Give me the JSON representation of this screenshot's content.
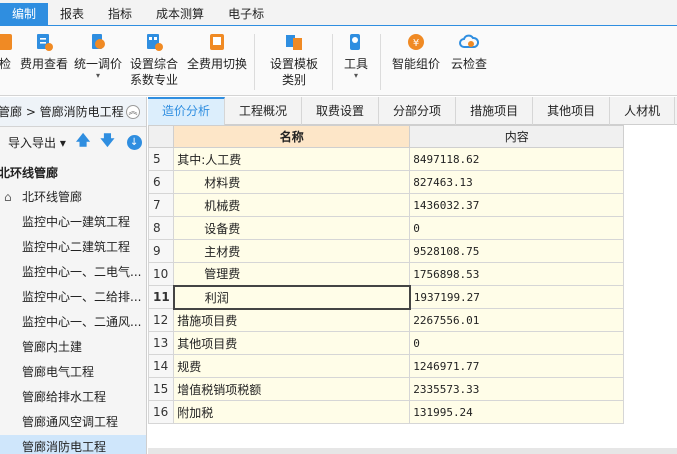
{
  "menu": [
    "编制",
    "报表",
    "指标",
    "成本测算",
    "电子标"
  ],
  "ribbon": {
    "buttons": [
      {
        "label1": "检",
        "label2": "",
        "icon": "check-icon",
        "dropdown": false
      },
      {
        "label1": "费用查看",
        "label2": "",
        "icon": "fee-view-icon",
        "dropdown": false
      },
      {
        "label1": "统一调价",
        "label2": "",
        "icon": "price-adjust-icon",
        "dropdown": true
      },
      {
        "label1": "设置综合",
        "label2": "系数专业",
        "icon": "calc-settings-icon",
        "dropdown": false
      },
      {
        "label1": "全费用切换",
        "label2": "",
        "icon": "full-fee-switch-icon",
        "dropdown": false
      },
      {
        "label1": "设置模板",
        "label2": "类别",
        "icon": "template-icon",
        "dropdown": false
      },
      {
        "label1": "工具",
        "label2": "",
        "icon": "tool-icon",
        "dropdown": true
      },
      {
        "label1": "智能组价",
        "label2": "",
        "icon": "smart-price-icon",
        "dropdown": false
      },
      {
        "label1": "云检查",
        "label2": "",
        "icon": "cloud-check-icon",
        "dropdown": false
      }
    ]
  },
  "breadcrumb": "管廊 > 管廊消防电工程",
  "left_panel": {
    "export_label": "导入导出",
    "root": "北环线管廊",
    "home": "北环线管廊",
    "items": [
      "监控中心一建筑工程",
      "监控中心二建筑工程",
      "监控中心一、二电气...",
      "监控中心一、二给排...",
      "监控中心一、二通风...",
      "管廊内土建",
      "管廊电气工程",
      "管廊给排水工程",
      "管廊通风空调工程",
      "管廊消防电工程"
    ]
  },
  "tabs": [
    "造价分析",
    "工程概况",
    "取费设置",
    "分部分项",
    "措施项目",
    "其他项目",
    "人材机"
  ],
  "grid": {
    "headers": {
      "name": "名称",
      "value": "内容"
    },
    "rows": [
      {
        "num": "5",
        "name": "其中:人工费",
        "value": "8497118.62",
        "indent": false
      },
      {
        "num": "6",
        "name": "材料费",
        "value": "827463.13",
        "indent": true
      },
      {
        "num": "7",
        "name": "机械费",
        "value": "1436032.37",
        "indent": true
      },
      {
        "num": "8",
        "name": "设备费",
        "value": "0",
        "indent": true
      },
      {
        "num": "9",
        "name": "主材费",
        "value": "9528108.75",
        "indent": true
      },
      {
        "num": "10",
        "name": "管理费",
        "value": "1756898.53",
        "indent": true
      },
      {
        "num": "11",
        "name": "利润",
        "value": "1937199.27",
        "indent": true
      },
      {
        "num": "12",
        "name": "措施项目费",
        "value": "2267556.01",
        "indent": false
      },
      {
        "num": "13",
        "name": "其他项目费",
        "value": "0",
        "indent": false
      },
      {
        "num": "14",
        "name": "规费",
        "value": "1246971.77",
        "indent": false
      },
      {
        "num": "15",
        "name": "增值税销项税额",
        "value": "2335573.33",
        "indent": false
      },
      {
        "num": "16",
        "name": "附加税",
        "value": "131995.24",
        "indent": false
      }
    ]
  },
  "colors": {
    "accent": "#2f8ee0",
    "name_header": "#fde6c8",
    "cell_bg": "#fffde8"
  }
}
